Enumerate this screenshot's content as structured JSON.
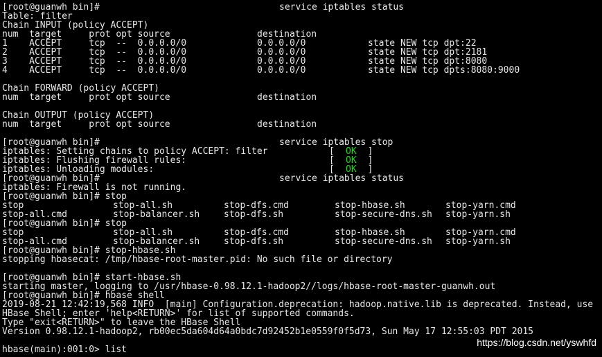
{
  "terminal": {
    "lines": [
      {
        "segments": [
          {
            "text": "[root@guanwh bin]#",
            "col": 0
          },
          {
            "text": "service iptables status",
            "col": 50
          }
        ]
      },
      {
        "segments": [
          {
            "text": "Table: filter",
            "col": 0
          }
        ]
      },
      {
        "segments": [
          {
            "text": "Chain INPUT (policy ACCEPT)",
            "col": 0
          }
        ]
      },
      {
        "segments": [
          {
            "text": "num  target     prot opt source",
            "col": 0
          },
          {
            "text": "destination",
            "col": 46
          }
        ]
      },
      {
        "segments": [
          {
            "text": "1    ACCEPT     tcp  --  0.0.0.0/0",
            "col": 0
          },
          {
            "text": "0.0.0.0/0",
            "col": 46
          },
          {
            "text": "state NEW tcp dpt:22",
            "col": 66
          }
        ]
      },
      {
        "segments": [
          {
            "text": "2    ACCEPT     tcp  --  0.0.0.0/0",
            "col": 0
          },
          {
            "text": "0.0.0.0/0",
            "col": 46
          },
          {
            "text": "state NEW tcp dpt:2181",
            "col": 66
          }
        ]
      },
      {
        "segments": [
          {
            "text": "3    ACCEPT     tcp  --  0.0.0.0/0",
            "col": 0
          },
          {
            "text": "0.0.0.0/0",
            "col": 46
          },
          {
            "text": "state NEW tcp dpt:8080",
            "col": 66
          }
        ]
      },
      {
        "segments": [
          {
            "text": "4    ACCEPT     tcp  --  0.0.0.0/0",
            "col": 0
          },
          {
            "text": "0.0.0.0/0",
            "col": 46
          },
          {
            "text": "state NEW tcp dpts:8080:9000",
            "col": 66
          }
        ]
      },
      {
        "segments": []
      },
      {
        "segments": [
          {
            "text": "Chain FORWARD (policy ACCEPT)",
            "col": 0
          }
        ]
      },
      {
        "segments": [
          {
            "text": "num  target     prot opt source",
            "col": 0
          },
          {
            "text": "destination",
            "col": 46
          }
        ]
      },
      {
        "segments": []
      },
      {
        "segments": [
          {
            "text": "Chain OUTPUT (policy ACCEPT)",
            "col": 0
          }
        ]
      },
      {
        "segments": [
          {
            "text": "num  target     prot opt source",
            "col": 0
          },
          {
            "text": "destination",
            "col": 46
          }
        ]
      },
      {
        "segments": []
      },
      {
        "segments": [
          {
            "text": "[root@guanwh bin]#",
            "col": 0
          },
          {
            "text": "service iptables stop",
            "col": 50
          }
        ]
      },
      {
        "segments": [
          {
            "text": "iptables: Setting chains to policy ACCEPT: filter",
            "col": 0
          },
          {
            "text": "[  ",
            "col": 59
          },
          {
            "text": "OK",
            "col": 62,
            "ok": true
          },
          {
            "text": "  ]",
            "col": 64
          }
        ]
      },
      {
        "segments": [
          {
            "text": "iptables: Flushing firewall rules:",
            "col": 0
          },
          {
            "text": "[  ",
            "col": 59
          },
          {
            "text": "OK",
            "col": 62,
            "ok": true
          },
          {
            "text": "  ]",
            "col": 64
          }
        ]
      },
      {
        "segments": [
          {
            "text": "iptables: Unloading modules:",
            "col": 0
          },
          {
            "text": "[  ",
            "col": 59
          },
          {
            "text": "OK",
            "col": 62,
            "ok": true
          },
          {
            "text": "  ]",
            "col": 64
          }
        ]
      },
      {
        "segments": [
          {
            "text": "[root@guanwh bin]#",
            "col": 0
          },
          {
            "text": "service iptables status",
            "col": 50
          }
        ]
      },
      {
        "segments": [
          {
            "text": "iptables: Firewall is not running.",
            "col": 0
          }
        ]
      },
      {
        "segments": [
          {
            "text": "[root@guanwh bin]# stop",
            "col": 0
          }
        ]
      },
      {
        "segments": [
          {
            "text": "stop",
            "col": 0
          },
          {
            "text": "stop-all.sh",
            "col": 20
          },
          {
            "text": "stop-dfs.cmd",
            "col": 40
          },
          {
            "text": "stop-hbase.sh",
            "col": 60
          },
          {
            "text": "stop-yarn.cmd",
            "col": 80
          }
        ]
      },
      {
        "segments": [
          {
            "text": "stop-all.cmd",
            "col": 0
          },
          {
            "text": "stop-balancer.sh",
            "col": 20
          },
          {
            "text": "stop-dfs.sh",
            "col": 40
          },
          {
            "text": "stop-secure-dns.sh",
            "col": 60
          },
          {
            "text": "stop-yarn.sh",
            "col": 80
          }
        ]
      },
      {
        "segments": [
          {
            "text": "[root@guanwh bin]# stop",
            "col": 0
          }
        ]
      },
      {
        "segments": [
          {
            "text": "stop",
            "col": 0
          },
          {
            "text": "stop-all.sh",
            "col": 20
          },
          {
            "text": "stop-dfs.cmd",
            "col": 40
          },
          {
            "text": "stop-hbase.sh",
            "col": 60
          },
          {
            "text": "stop-yarn.cmd",
            "col": 80
          }
        ]
      },
      {
        "segments": [
          {
            "text": "stop-all.cmd",
            "col": 0
          },
          {
            "text": "stop-balancer.sh",
            "col": 20
          },
          {
            "text": "stop-dfs.sh",
            "col": 40
          },
          {
            "text": "stop-secure-dns.sh",
            "col": 60
          },
          {
            "text": "stop-yarn.sh",
            "col": 80
          }
        ]
      },
      {
        "segments": [
          {
            "text": "[root@guanwh bin]# stop-hbase.sh",
            "col": 0
          }
        ]
      },
      {
        "segments": [
          {
            "text": "stopping hbasecat: /tmp/hbase-root-master.pid: No such file or directory",
            "col": 0
          }
        ]
      },
      {
        "segments": []
      },
      {
        "segments": [
          {
            "text": "[root@guanwh bin]# start-hbase.sh",
            "col": 0
          }
        ]
      },
      {
        "segments": [
          {
            "text": "starting master, logging to /usr/hbase-0.98.12.1-hadoop2//logs/hbase-root-master-guanwh.out",
            "col": 0
          }
        ]
      },
      {
        "segments": [
          {
            "text": "[root@guanwh bin]# hbase shell",
            "col": 0
          }
        ]
      },
      {
        "segments": [
          {
            "text": "2019-08-21 12:42:19,568 INFO  [main] Configuration.deprecation: hadoop.native.lib is deprecated. Instead, use",
            "col": 0
          }
        ]
      },
      {
        "segments": [
          {
            "text": "HBase Shell; enter 'help<RETURN>' for list of supported commands.",
            "col": 0
          }
        ]
      },
      {
        "segments": [
          {
            "text": "Type \"exit<RETURN>\" to leave the HBase Shell",
            "col": 0
          }
        ]
      },
      {
        "segments": [
          {
            "text": "Version 0.98.12.1-hadoop2, rb00ec5da604d64a0bdc7d92452b1e0559f0f5d73, Sun May 17 12:55:03 PDT 2015",
            "col": 0
          }
        ]
      },
      {
        "segments": []
      },
      {
        "segments": [
          {
            "text": "hbase(main):001:0> list",
            "col": 0
          }
        ]
      }
    ],
    "colors": {
      "background": "#000000",
      "foreground": "#e6e6e6",
      "ok": "#2ecc2e"
    }
  },
  "watermark": "https://blog.csdn.net/yswhfd"
}
